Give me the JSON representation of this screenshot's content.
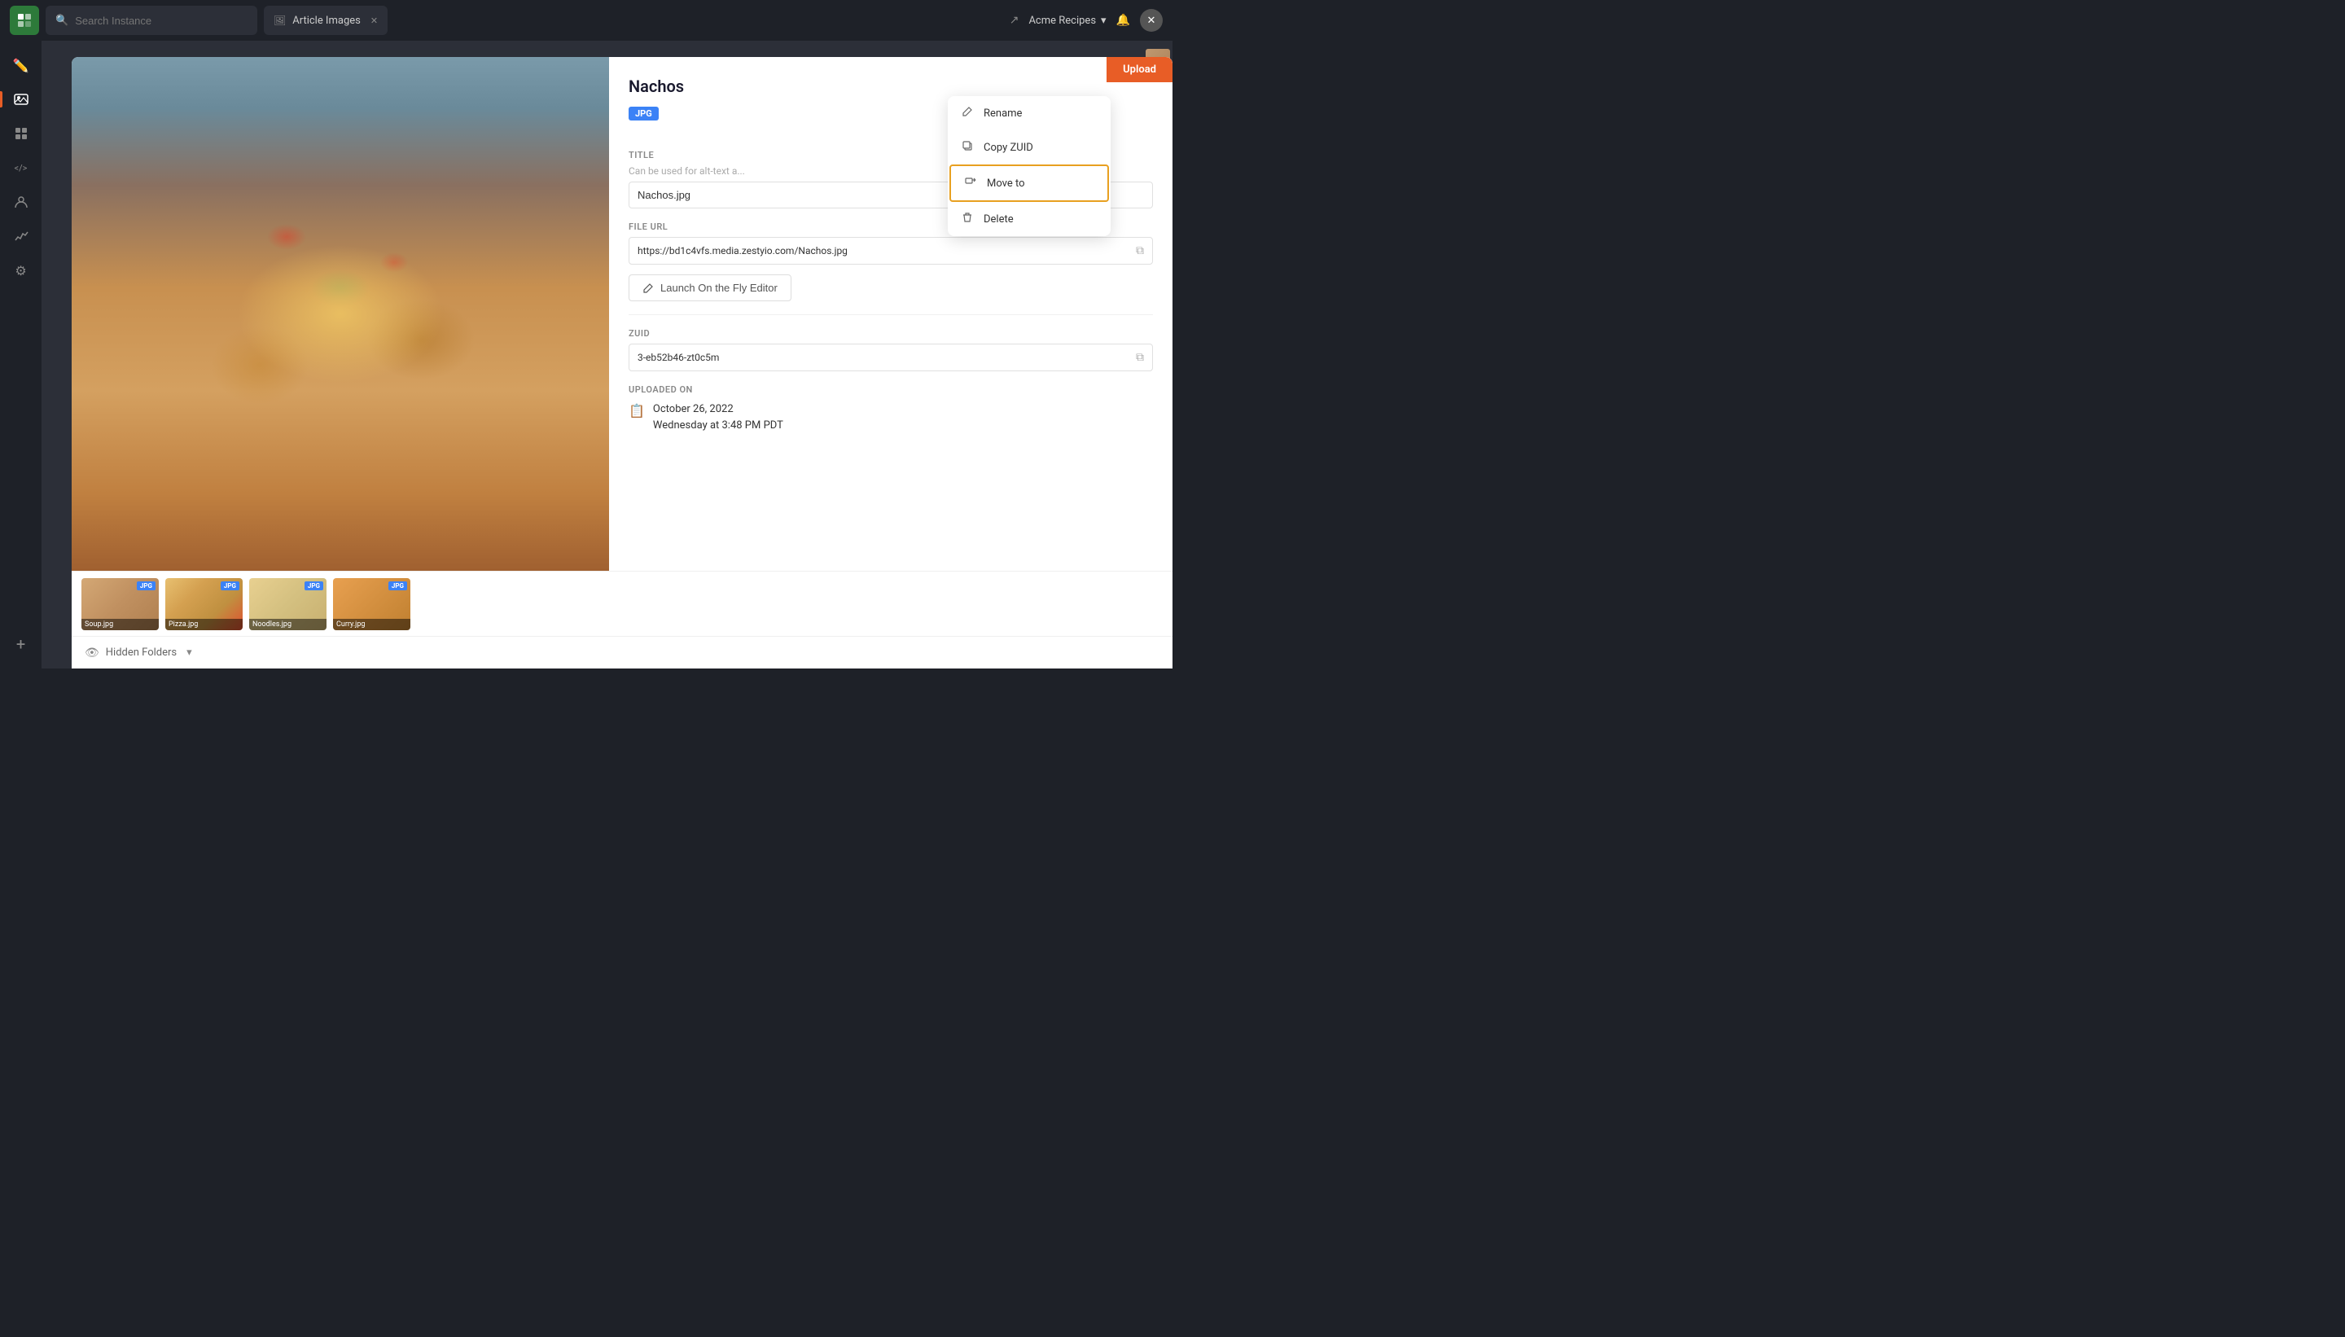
{
  "topbar": {
    "search_placeholder": "Search Instance",
    "tab_icon": "🖼",
    "tab_label": "Article Images",
    "instance_label": "Acme Recipes",
    "upload_label": "Upload"
  },
  "sidebar": {
    "icons": [
      {
        "name": "edit-icon",
        "symbol": "✏️",
        "active": false
      },
      {
        "name": "media-icon",
        "symbol": "🖼",
        "active": true
      },
      {
        "name": "layers-icon",
        "symbol": "⬜",
        "active": false
      },
      {
        "name": "code-icon",
        "symbol": "</>",
        "active": false
      },
      {
        "name": "person-icon",
        "symbol": "👤",
        "active": false
      },
      {
        "name": "settings-icon",
        "symbol": "⚙",
        "active": false
      },
      {
        "name": "analytics-icon",
        "symbol": "📊",
        "active": false
      },
      {
        "name": "add-icon",
        "symbol": "+",
        "active": false
      }
    ]
  },
  "modal": {
    "file_name": "Nachos",
    "file_type": "JPG",
    "title_label": "Title",
    "title_hint": "Can be used for alt-text a...",
    "title_value": "Nachos.jpg",
    "file_url_label": "File URL",
    "file_url": "https://bd1c4vfs.media.zestyio.com/Nachos.jpg",
    "launch_btn_label": "Launch On the Fly Editor",
    "zuid_label": "ZUID",
    "zuid_value": "3-eb52b46-zt0c5m",
    "uploaded_on_label": "UPLOADED ON",
    "uploaded_date": "October 26, 2022",
    "uploaded_time": "Wednesday at 3:48 PM PDT"
  },
  "context_menu": {
    "rename_label": "Rename",
    "copy_label": "Copy ZUID",
    "move_label": "Move to",
    "delete_label": "Delete"
  },
  "thumbnails": [
    {
      "label": "Soup.jpg",
      "badge": "JPG",
      "class": "thumb-soup"
    },
    {
      "label": "Pizza.jpg",
      "badge": "JPG",
      "class": "thumb-pizza"
    },
    {
      "label": "Noodles.jpg",
      "badge": "JPG",
      "class": "thumb-noodles"
    },
    {
      "label": "Curry.jpg",
      "badge": "JPG",
      "class": "thumb-curry"
    }
  ],
  "folders_bar": {
    "hidden_folders_label": "Hidden Folders"
  }
}
